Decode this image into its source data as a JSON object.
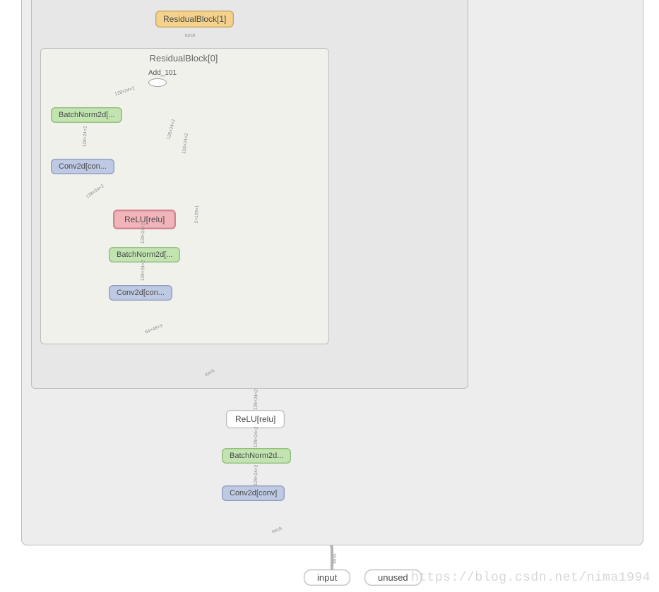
{
  "diagram": {
    "outer_group": {
      "implied_title": ""
    },
    "residual1": {
      "label": "ResidualBlock[1]"
    },
    "residual0": {
      "title": "ResidualBlock[0]",
      "add": {
        "label": "Add_101"
      },
      "bn2": {
        "label": "BatchNorm2d[..."
      },
      "conv2": {
        "label": "Conv2d[con..."
      },
      "relu": {
        "label": "ReLU[relu]"
      },
      "bn1": {
        "label": "BatchNorm2d[..."
      },
      "conv1": {
        "label": "Conv2d[con..."
      }
    },
    "tail": {
      "relu": {
        "label": "ReLU[relu]"
      },
      "bn": {
        "label": "BatchNorm2d..."
      },
      "conv": {
        "label": "Conv2d[conv]"
      }
    },
    "legend": {
      "input": "input",
      "unused": "unused"
    },
    "edge_labels": {
      "e1": "torch",
      "e2": "128×24×2",
      "e3": "128×24×2",
      "e4": "128×24×2",
      "e5": "128×24×2",
      "e6": "128×24×2",
      "e7": "128×24×2",
      "e8": "128×24×2",
      "e9": "2×128×1",
      "e10": "64×48×3",
      "e11": "torch",
      "e12": "torch"
    }
  },
  "watermark": "https://blog.csdn.net/nima1994"
}
